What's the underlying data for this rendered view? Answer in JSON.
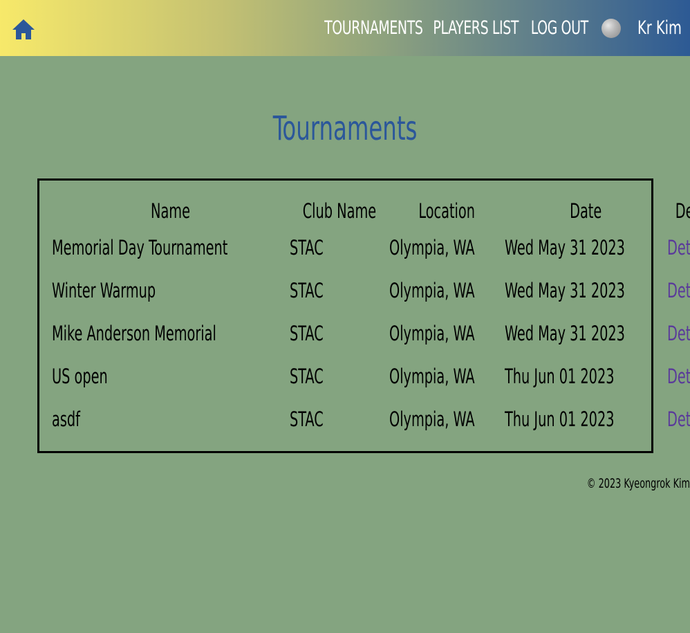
{
  "navbar": {
    "home_icon": "home-icon",
    "links": {
      "tournaments": "TOURNAMENTS",
      "players_list": "PLAYERS LIST",
      "log_out": "LOG OUT"
    },
    "user_name": "Kr Kim",
    "colors": {
      "gradient_start": "#f7e96a",
      "gradient_end": "#2d5a94",
      "icon": "#2b579a"
    }
  },
  "page_title": "Tournaments",
  "table": {
    "headers": [
      "Name",
      "Club Name",
      "Location",
      "Date",
      "Details"
    ],
    "rows": [
      {
        "name": "Memorial Day Tournament",
        "club": "STAC",
        "location": "Olympia, WA",
        "date": "Wed May 31 2023",
        "details": "Details"
      },
      {
        "name": "Winter Warmup",
        "club": "STAC",
        "location": "Olympia, WA",
        "date": "Wed May 31 2023",
        "details": "Details"
      },
      {
        "name": "Mike Anderson Memorial",
        "club": "STAC",
        "location": "Olympia, WA",
        "date": "Wed May 31 2023",
        "details": "Details"
      },
      {
        "name": "US open",
        "club": "STAC",
        "location": "Olympia, WA",
        "date": "Thu Jun 01 2023",
        "details": "Details"
      },
      {
        "name": "asdf",
        "club": "STAC",
        "location": "Olympia, WA",
        "date": "Thu Jun 01 2023",
        "details": "Details"
      }
    ]
  },
  "footer": "© 2023 Kyeongrok Kim",
  "colors": {
    "background": "#84a480",
    "title": "#2b579a",
    "link": "#5a3a9a"
  }
}
